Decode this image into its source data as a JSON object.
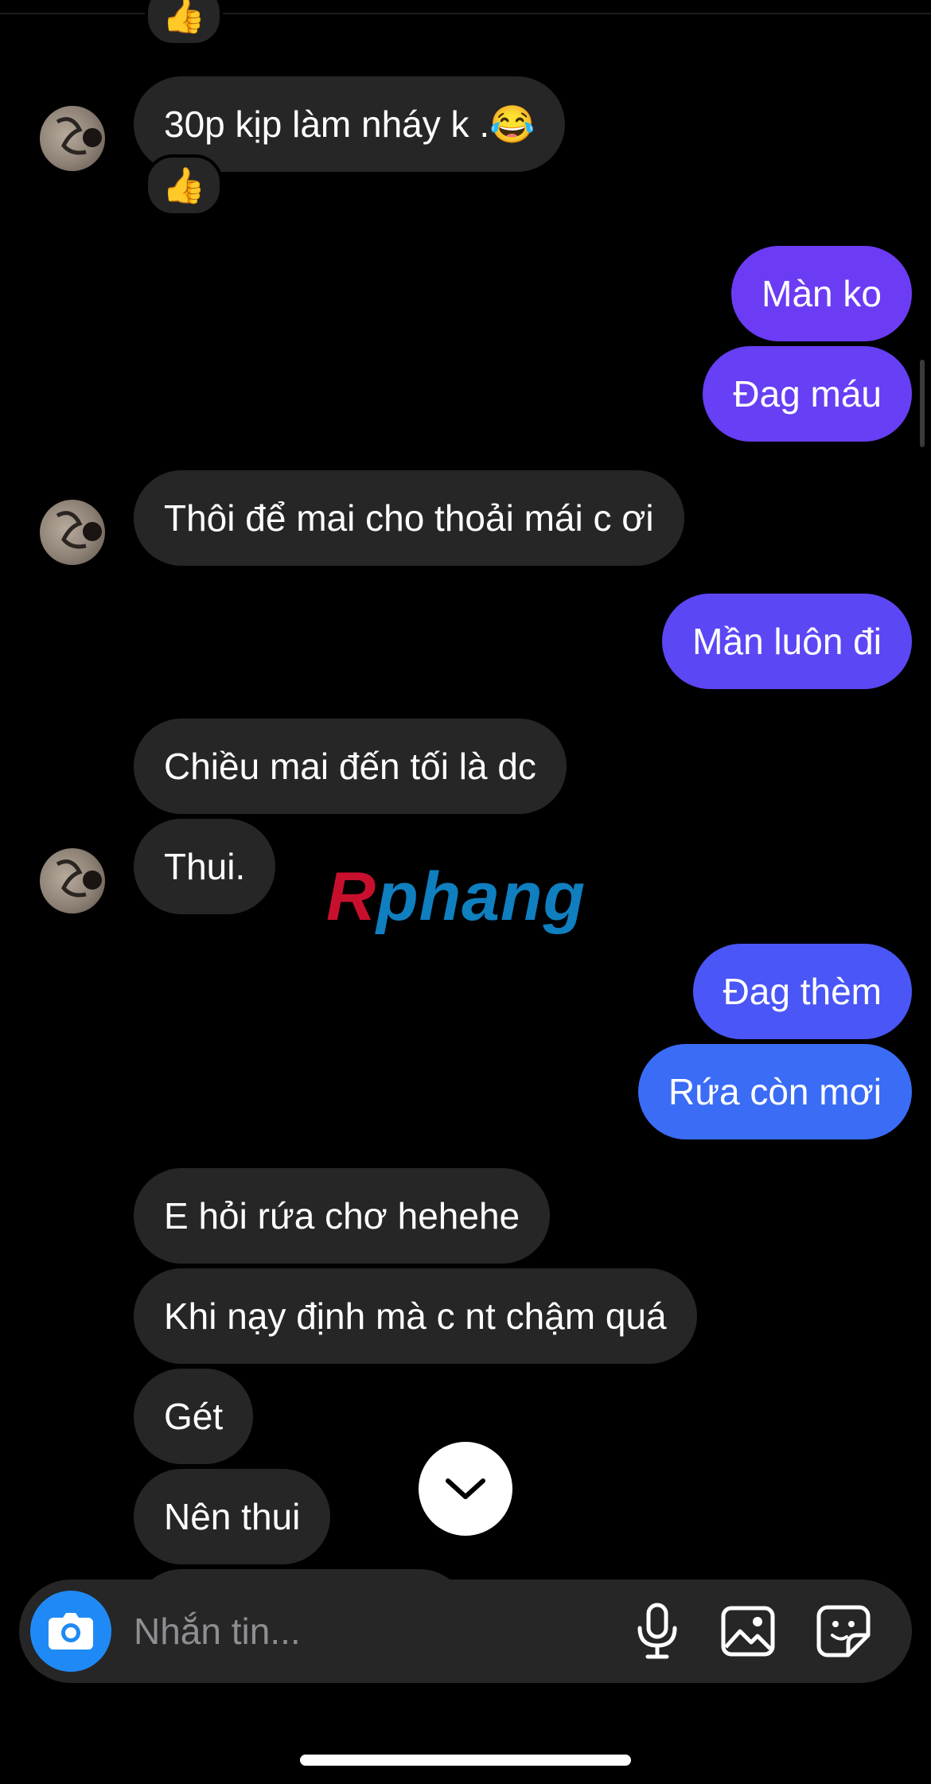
{
  "messages": [
    {
      "text": "30p kịp làm nháy k .😂",
      "reaction": "👍"
    },
    {
      "text": "Màn ko"
    },
    {
      "text": "Đag máu"
    },
    {
      "text": "Thôi để mai cho thoải mái c ơi"
    },
    {
      "text": "Mần luôn đi"
    },
    {
      "text": "Chiều mai đến tối là dc"
    },
    {
      "text": "Thui."
    },
    {
      "text": "Đag thèm"
    },
    {
      "text": "Rứa còn mơi"
    },
    {
      "text": "E hỏi rứa chơ hehehe"
    },
    {
      "text": "Khi nạy định mà c nt chậm quá"
    },
    {
      "text": "Gét"
    },
    {
      "text": "Nên thui"
    }
  ],
  "top_reaction": "👍",
  "watermark": {
    "part1": "R",
    "part2": "phang"
  },
  "composer": {
    "placeholder": "Nhắn tin..."
  },
  "icons": {
    "camera": "camera-icon",
    "mic": "microphone-icon",
    "gallery": "image-icon",
    "sticker": "sticker-icon",
    "scroll": "chevron-down-icon"
  },
  "colors": {
    "incoming_bubble": "#262626",
    "outgoing_purple": "#6a3cf5",
    "outgoing_blue": "#3a6cf6",
    "camera_button": "#1f8af5",
    "background": "#000000"
  }
}
